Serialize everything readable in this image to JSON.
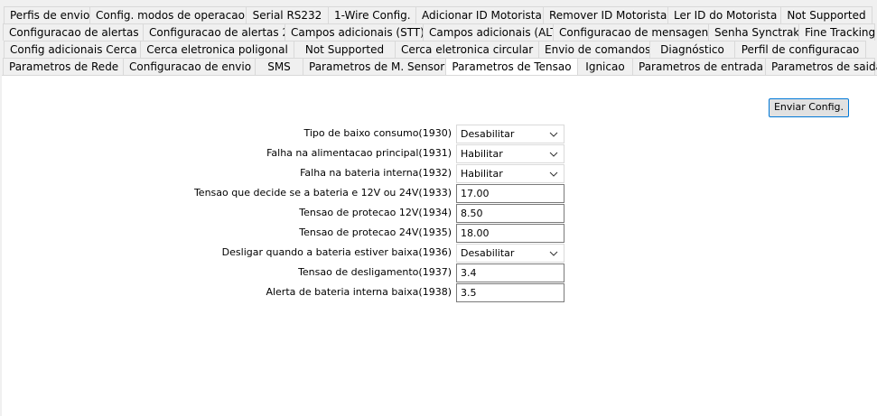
{
  "tabs": {
    "row1": [
      "Perfis de envio",
      "Config. modos de operacao",
      "Serial RS232",
      "1-Wire Config.",
      "Adicionar ID Motorista",
      "Remover ID Motorista",
      "Ler ID do Motorista",
      "Not Supported"
    ],
    "row2": [
      "Configuracao de alertas 1",
      "Configuracao de alertas 2",
      "Campos adicionais (STT)",
      "Campos adicionais (ALT)",
      "Configuracao de mensagens",
      "Senha Synctrak",
      "Fine Tracking"
    ],
    "row3": [
      "Config adicionais Cerca",
      "Cerca eletronica poligonal",
      "Not Supported",
      "Cerca eletronica circular",
      "Envio de comandos",
      "Diagnóstico",
      "Perfil de configuracao"
    ],
    "row4": [
      "Parametros de Rede",
      "Configuracao de envio",
      "SMS",
      "Parametros de M. Sensor",
      "Parametros de Tensao",
      "Ignicao",
      "Parametros de entrada",
      "Parametros de saida"
    ],
    "active": "Parametros de Tensao"
  },
  "send_button": "Enviar Config.",
  "fields": [
    {
      "label": "Tipo de baixo consumo(1930)",
      "value": "Desabilitar",
      "type": "select"
    },
    {
      "label": "Falha na alimentacao principal(1931)",
      "value": "Habilitar",
      "type": "select"
    },
    {
      "label": "Falha na bateria interna(1932)",
      "value": "Habilitar",
      "type": "select"
    },
    {
      "label": "Tensao que decide se a bateria e 12V ou 24V(1933)",
      "value": "17.00",
      "type": "text"
    },
    {
      "label": "Tensao de protecao 12V(1934)",
      "value": "8.50",
      "type": "text"
    },
    {
      "label": "Tensao de protecao 24V(1935)",
      "value": "18.00",
      "type": "text"
    },
    {
      "label": "Desligar quando a bateria estiver baixa(1936)",
      "value": "Desabilitar",
      "type": "select"
    },
    {
      "label": "Tensao de desligamento(1937)",
      "value": "3.4",
      "type": "text"
    },
    {
      "label": "Alerta de bateria interna baixa(1938)",
      "value": "3.5",
      "type": "text"
    }
  ]
}
